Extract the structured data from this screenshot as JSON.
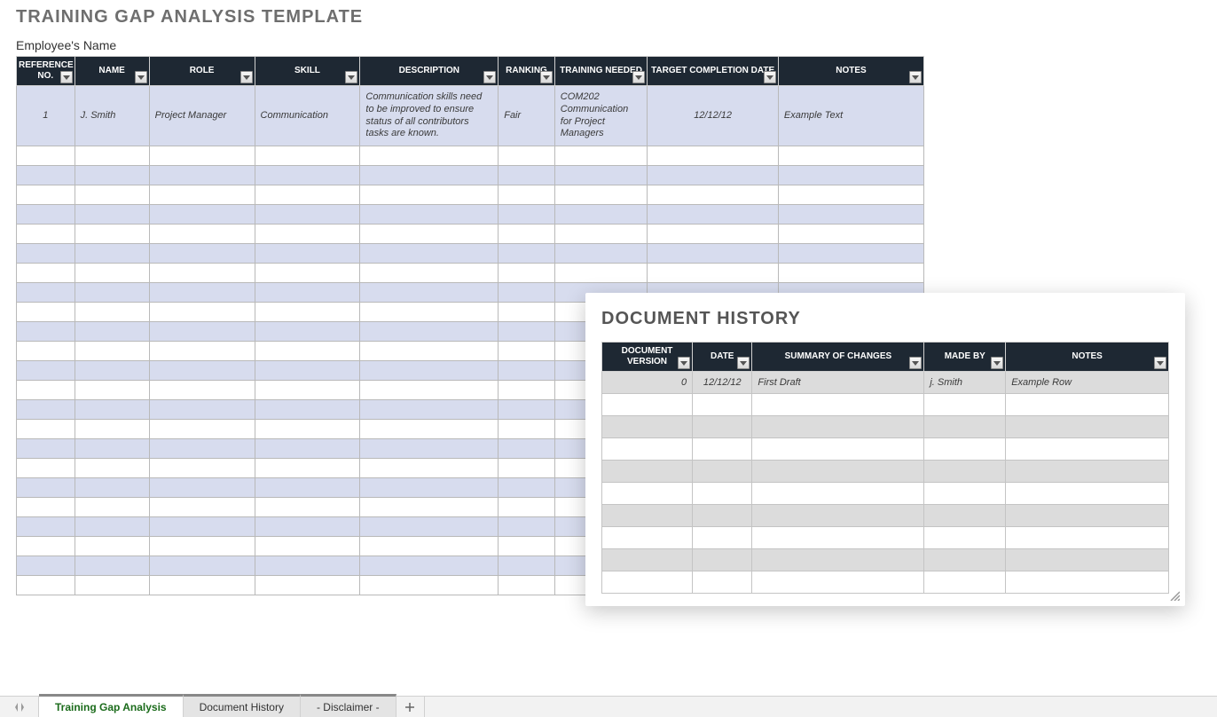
{
  "main": {
    "title": "TRAINING GAP ANALYSIS TEMPLATE",
    "subtitle": "Employee's Name",
    "headers": [
      "REFERENCE NO.",
      "NAME",
      "ROLE",
      "SKILL",
      "DESCRIPTION",
      "RANKING",
      "TRAINING NEEDED",
      "TARGET COMPLETION DATE",
      "NOTES"
    ],
    "row": {
      "ref": "1",
      "name": "J. Smith",
      "role": "Project Manager",
      "skill": "Communication",
      "desc": "Communication skills need to be improved to ensure status of all contributors tasks are known.",
      "rank": "Fair",
      "training": "COM202 Communication for Project Managers",
      "date": "12/12/12",
      "notes": "Example Text"
    },
    "empty_rows": 23
  },
  "history": {
    "title": "DOCUMENT HISTORY",
    "headers": [
      "DOCUMENT VERSION",
      "DATE",
      "SUMMARY OF CHANGES",
      "MADE BY",
      "NOTES"
    ],
    "row": {
      "version": "0",
      "date": "12/12/12",
      "summary": "First Draft",
      "madeby": "j. Smith",
      "notes": "Example Row"
    },
    "empty_rows": 9
  },
  "tabs": [
    "Training Gap Analysis",
    "Document History",
    "- Disclaimer -"
  ]
}
